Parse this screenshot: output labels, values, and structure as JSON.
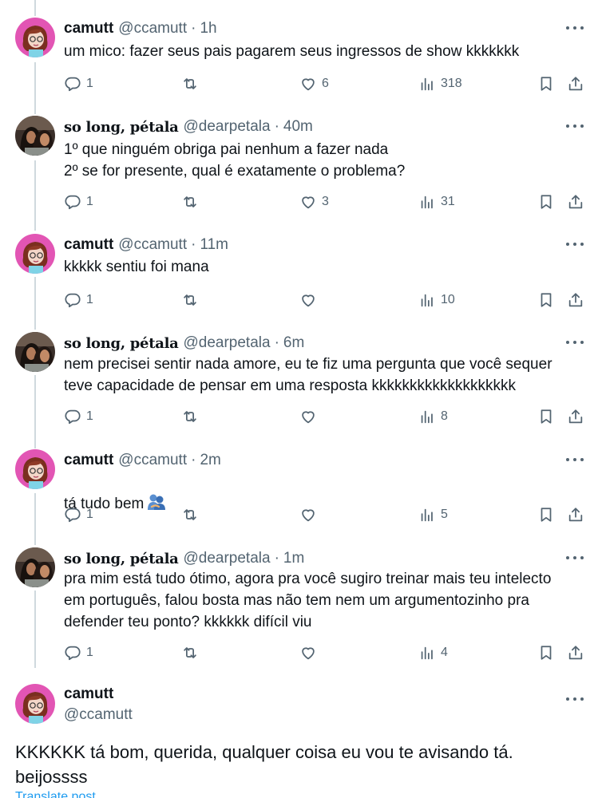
{
  "tweets": [
    {
      "name": "camutt",
      "handle": "@ccamutt",
      "time": "1h",
      "text": "um mico: fazer seus pais pagarem seus ingressos de show kkkkkkk",
      "replies": "1",
      "retweets": "",
      "likes": "6",
      "views": "318",
      "avatar": "camutt-avatar"
    },
    {
      "name": "so long, pétala",
      "handle": "@dearpetala",
      "time": "40m",
      "text": "1º que ninguém obriga pai nenhum a fazer nada\n2º se for presente, qual é exatamente o problema?",
      "replies": "1",
      "retweets": "",
      "likes": "3",
      "views": "31",
      "avatar": "petala-avatar"
    },
    {
      "name": "camutt",
      "handle": "@ccamutt",
      "time": "11m",
      "text": "kkkkk sentiu foi mana",
      "replies": "1",
      "retweets": "",
      "likes": "",
      "views": "10",
      "avatar": "camutt-avatar"
    },
    {
      "name": "so long, pétala",
      "handle": "@dearpetala",
      "time": "6m",
      "text": "nem precisei sentir nada amore, eu te fiz uma pergunta que você sequer\nteve capacidade de pensar em uma resposta kkkkkkkkkkkkkkkkkkk",
      "replies": "1",
      "retweets": "",
      "likes": "",
      "views": "8",
      "avatar": "petala-avatar"
    },
    {
      "name": "camutt",
      "handle": "@ccamutt",
      "time": "2m",
      "text": "tá tudo bem",
      "replies": "1",
      "retweets": "",
      "likes": "",
      "views": "5",
      "avatar": "camutt-avatar"
    },
    {
      "name": "so long, pétala",
      "handle": "@dearpetala",
      "time": "1m",
      "text": "pra mim está tudo ótimo, agora pra você sugiro treinar mais teu intelecto\nem português, falou bosta mas não tem nem um argumentozinho pra\ndefender teu ponto? kkkkkk difícil viu",
      "replies": "1",
      "retweets": "",
      "likes": "",
      "views": "4",
      "avatar": "petala-avatar"
    }
  ],
  "main_tweet": {
    "name": "camutt",
    "handle": "@ccamutt",
    "text": "KKKKKK tá bom, querida, qualquer coisa eu vou te avisando tá.\nbeijossss",
    "translate": "Translate post"
  },
  "separator": "·",
  "colors": {
    "text": "#0f1419",
    "secondary": "#536471",
    "link": "#1d9bf0",
    "thread_line": "#cfd9de",
    "camutt_avatar_bg": "#e255b4",
    "petala_avatar_bg": "#3a2f2a"
  }
}
